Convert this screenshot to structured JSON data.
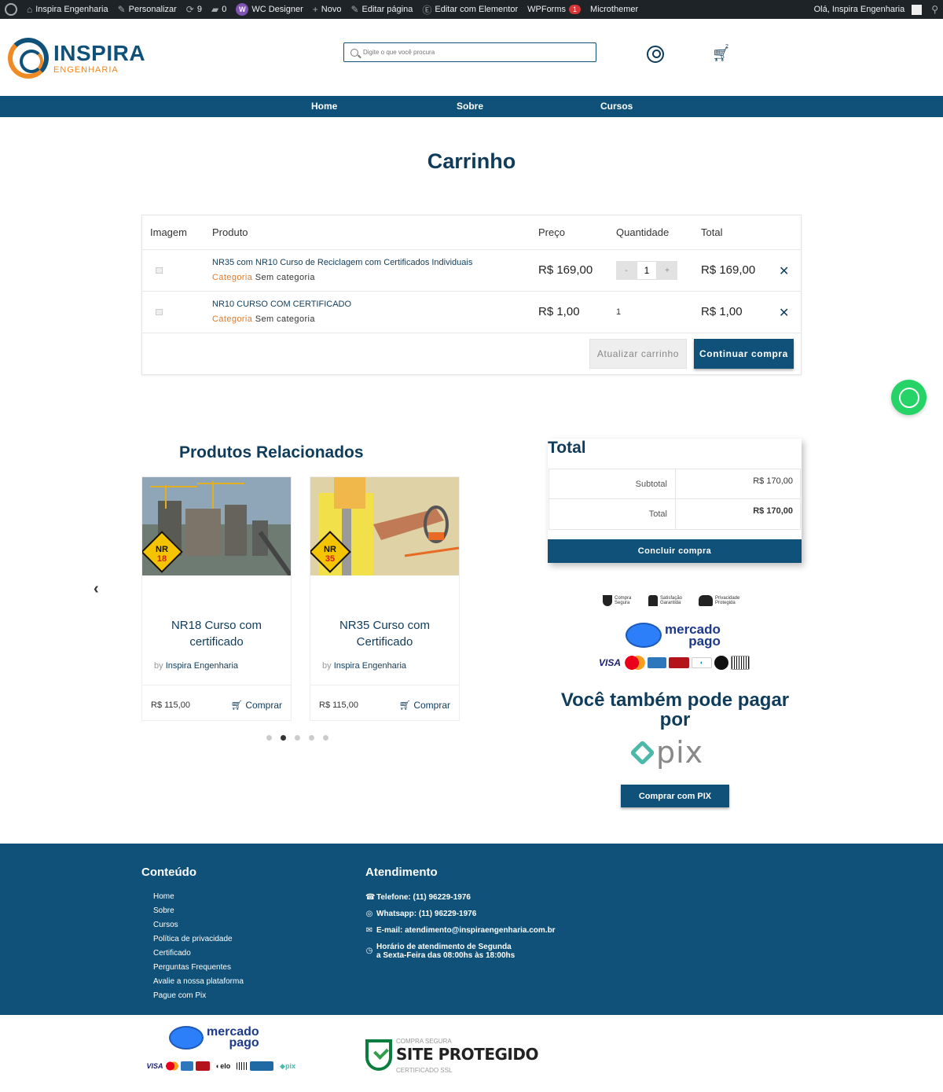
{
  "adminbar": {
    "site": "Inspira Engenharia",
    "personalize": "Personalizar",
    "updates": "9",
    "comments": "0",
    "wc_designer": "WC Designer",
    "new": "Novo",
    "edit_page": "Editar página",
    "edit_elementor": "Editar com Elementor",
    "wpforms": "WPForms",
    "wpforms_badge": "1",
    "microthemer": "Microthemer",
    "greeting": "Olá, Inspira Engenharia"
  },
  "header": {
    "logo_name": "INSPIRA",
    "logo_sub": "ENGENHARIA",
    "search_placeholder": "Digite o que você procura",
    "cart_count": "2"
  },
  "nav": {
    "items": [
      "Home",
      "Sobre",
      "Cursos"
    ]
  },
  "page": {
    "title": "Carrinho"
  },
  "cart": {
    "headers": {
      "image": "Imagem",
      "product": "Produto",
      "price": "Preço",
      "quantity": "Quantidade",
      "total": "Total"
    },
    "category_label": "Categoria",
    "items": [
      {
        "name": "NR35 com NR10 Curso de Reciclagem com Certificados Individuais",
        "category": "Sem categoria",
        "price": "R$ 169,00",
        "quantity": "1",
        "total": "R$ 169,00",
        "qty_minus": "-",
        "qty_plus": "+"
      },
      {
        "name": "NR10 CURSO COM CERTIFICADO",
        "category": "Sem categoria",
        "price": "R$ 1,00",
        "quantity": "1",
        "total": "R$ 1,00"
      }
    ],
    "remove_symbol": "✕",
    "update_label": "Atualizar carrinho",
    "continue_label": "Continuar compra"
  },
  "related": {
    "title": "Produtos Relacionados",
    "by_label": "by",
    "products": [
      {
        "title": "NR18 Curso com certificado",
        "badge_top": "NR",
        "badge_num": "18",
        "vendor": "Inspira Engenharia",
        "price": "R$ 115,00",
        "buy": "Comprar"
      },
      {
        "title": "NR35 Curso com Certificado",
        "badge_top": "NR",
        "badge_num": "35",
        "vendor": "Inspira Engenharia",
        "price": "R$ 115,00",
        "buy": "Comprar"
      }
    ],
    "active_dot": 1,
    "dot_count": 5
  },
  "totals": {
    "title": "Total",
    "subtotal_label": "Subtotal",
    "subtotal_value": "R$ 170,00",
    "total_label": "Total",
    "total_value": "R$ 170,00",
    "finish_label": "Concluir compra"
  },
  "trust": {
    "secure": [
      "Compra",
      "Segura"
    ],
    "satisfaction": [
      "Satisfação",
      "Garantida"
    ],
    "privacy": [
      "Privacidade",
      "Protegida"
    ]
  },
  "payments": {
    "mp_line1": "mercado",
    "mp_line2": "pago",
    "pix_heading": "Você também pode pagar por",
    "pix_word": "pix",
    "pix_button": "Comprar com PIX"
  },
  "footer": {
    "content_title": "Conteúdo",
    "links": [
      "Home",
      "Sobre",
      "Cursos",
      "Política de privacidade",
      "Certificado",
      "Perguntas Frequentes",
      "Avalie a nossa plataforma",
      "Pague com Pix"
    ],
    "support_title": "Atendimento",
    "phone": "Telefone: (11) 96229-1976",
    "whatsapp": "Whatsapp: (11) 96229-1976",
    "email": "E-mail: atendimento@inspiraengenharia.com.br",
    "hours_1": "Horário de atendimento de Segunda",
    "hours_2": "a Sexta-Feira das 08:00hs às 18:00hs"
  },
  "ssl": {
    "top": "COMPRA SEGURA",
    "main": "SITE PROTEGIDO",
    "bottom": "CERTIFICADO SSL"
  },
  "colors": {
    "primary": "#0f5178",
    "accent": "#f08a24",
    "whatsapp": "#25d366"
  }
}
